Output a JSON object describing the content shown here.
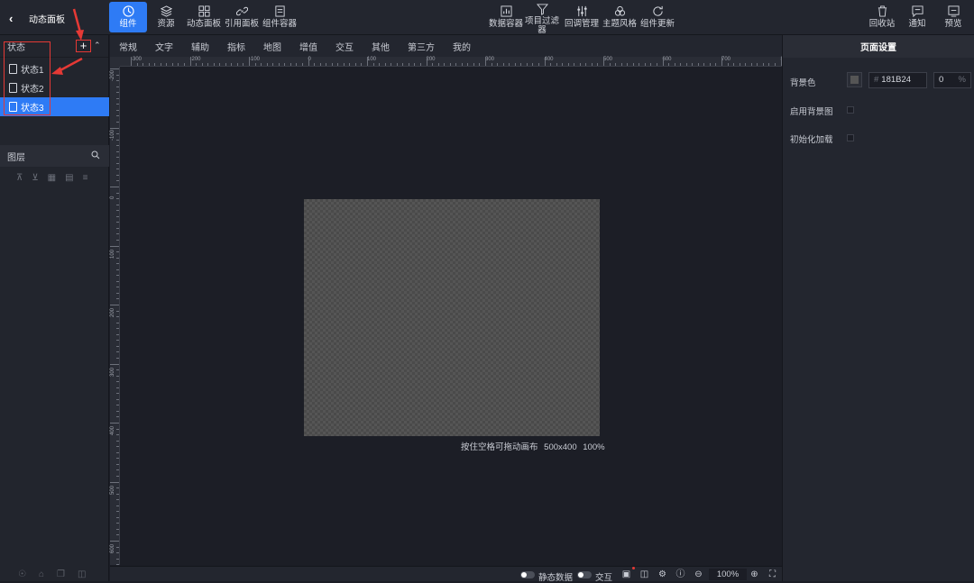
{
  "header": {
    "back_title": "动态面板",
    "left_tools": [
      {
        "label": "组件",
        "icon": "component-icon",
        "active": true
      },
      {
        "label": "资源",
        "icon": "layers-icon"
      },
      {
        "label": "动态面板",
        "icon": "grid-icon"
      },
      {
        "label": "引用面板",
        "icon": "link-icon"
      },
      {
        "label": "组件容器",
        "icon": "doc-icon"
      }
    ],
    "center_tools": [
      {
        "label": "数据容器",
        "icon": "chart-icon"
      },
      {
        "label": "项目过滤器",
        "icon": "filter-icon"
      },
      {
        "label": "回调管理",
        "icon": "sliders-icon"
      },
      {
        "label": "主题风格",
        "icon": "palette-icon"
      },
      {
        "label": "组件更新",
        "icon": "refresh-icon"
      }
    ],
    "right_tools": [
      {
        "label": "回收站",
        "icon": "trash-icon"
      },
      {
        "label": "通知",
        "icon": "message-icon"
      },
      {
        "label": "预览",
        "icon": "preview-icon"
      }
    ]
  },
  "states": {
    "title": "状态",
    "add": "+",
    "items": [
      "状态1",
      "状态2",
      "状态3"
    ],
    "active_index": 2
  },
  "layers": {
    "title": "图层"
  },
  "tabs": [
    "常规",
    "文字",
    "辅助",
    "指标",
    "地图",
    "增值",
    "交互",
    "其他",
    "第三方",
    "我的"
  ],
  "ruler": {
    "h_labels": [
      "-300",
      "-200",
      "-100",
      "0",
      "100",
      "200",
      "300",
      "400",
      "500",
      "600",
      "700",
      "8"
    ],
    "v_labels": [
      "-200",
      "-100",
      "0",
      "100",
      "200",
      "300",
      "400",
      "500",
      "600"
    ]
  },
  "canvas": {
    "hint": "按住空格可拖动画布",
    "size": "500x400",
    "zoom": "100%"
  },
  "bottombar": {
    "static_data": "静态数据",
    "interaction": "交互",
    "zoom": "100%"
  },
  "page_settings": {
    "title": "页面设置",
    "bg_color_label": "背景色",
    "bg_color_hash": "#",
    "bg_color_value": "181B24",
    "opacity_value": "0",
    "opacity_unit": "%",
    "enable_bg_image_label": "启用背景图",
    "init_load_label": "初始化加载"
  }
}
